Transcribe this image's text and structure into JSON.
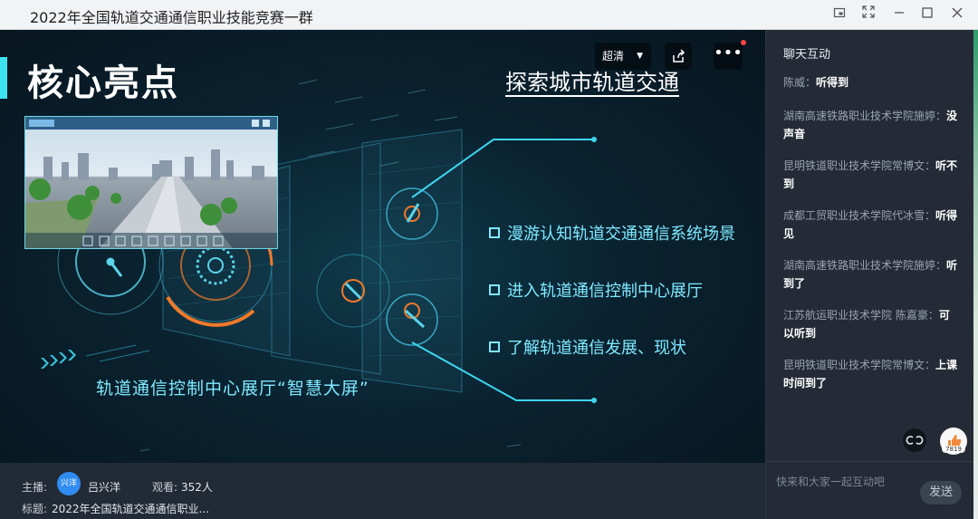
{
  "window": {
    "title": "2022年全国轨道交通通信职业技能竞赛一群",
    "buttons": [
      "pin-window",
      "fullscreen",
      "minimize",
      "maximize",
      "close"
    ]
  },
  "video": {
    "quality_label": "超清",
    "slide": {
      "title": "核心亮点",
      "subtitle": "探索城市轨道交通",
      "bullets": [
        "漫游认知轨道交通通信系统场景",
        "进入轨道通信控制中心展厅",
        "了解轨道通信发展、现状"
      ],
      "caption": "轨道通信控制中心展厅“智慧大屏”"
    }
  },
  "stream_info": {
    "host_label": "主播:",
    "host_avatar_text": "兴洋",
    "host_name": "吕兴洋",
    "viewers_label": "观看:",
    "viewers_value": "352人",
    "topic_label": "标题:",
    "topic_value": "2022年全国轨道交通通信职业..."
  },
  "chat": {
    "header": "聊天互动",
    "messages": [
      {
        "sender": "陈威：",
        "text": "听得到"
      },
      {
        "sender": "湖南高速铁路职业技术学院施婷：",
        "text": "没声音"
      },
      {
        "sender": "昆明铁道职业技术学院常博文：",
        "text": "听不到"
      },
      {
        "sender": "成都工贸职业技术学院代冰雪：",
        "text": "听得见"
      },
      {
        "sender": "湖南高速铁路职业技术学院施婷：",
        "text": "听到了"
      },
      {
        "sender": "江苏航运职业技术学院 陈嘉豪：",
        "text": "可以听到"
      },
      {
        "sender": "昆明铁道职业技术学院常博文：",
        "text": "上课时间到了"
      }
    ],
    "like_count": "7819",
    "input_placeholder": "快来和大家一起互动吧",
    "send_label": "发送"
  },
  "colors": {
    "accent_cyan": "#3fe2f0",
    "text_cyan": "#7fe9ff",
    "orange": "#f07a2a",
    "chat_bg": "#242b36"
  }
}
